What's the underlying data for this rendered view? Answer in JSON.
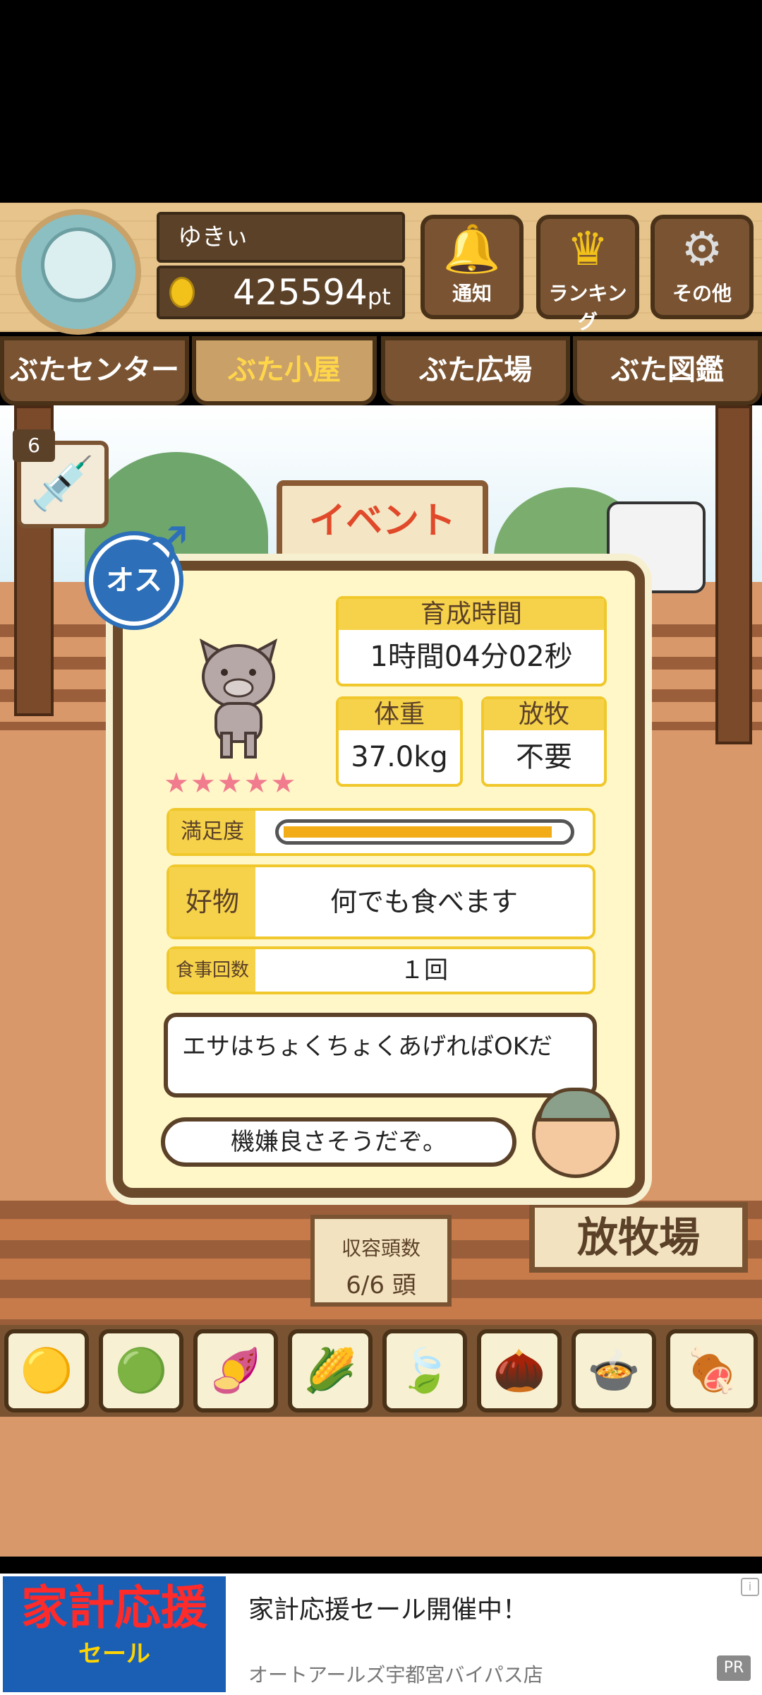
{
  "profile": {
    "name": "ゆきぃ",
    "points": "425594",
    "points_unit": "pt"
  },
  "top_buttons": [
    {
      "label": "通知",
      "icon": "bell-icon"
    },
    {
      "label": "ランキング",
      "icon": "crown-icon"
    },
    {
      "label": "その他",
      "icon": "gear-icon"
    }
  ],
  "tabs": [
    {
      "label": "ぶたセンター",
      "active": false
    },
    {
      "label": "ぶた小屋",
      "active": true
    },
    {
      "label": "ぶた広場",
      "active": false
    },
    {
      "label": "ぶた図鑑",
      "active": false
    }
  ],
  "scene": {
    "event_sign": "イベント",
    "item_count": "6"
  },
  "pig": {
    "gender_label": "オス",
    "stars": "★★★★★",
    "raising_time_label": "育成時間",
    "raising_time": "1時間04分02秒",
    "weight_label": "体重",
    "weight": "37.0kg",
    "pasture_label": "放牧",
    "pasture": "不要",
    "satisfaction_label": "満足度",
    "satisfaction_fraction": 0.95,
    "favorite_label": "好物",
    "favorite": "何でも食べます",
    "meals_label": "食事回数",
    "meals": "１回",
    "tip": "エサはちょくちょくあげればOKだ",
    "comment": "機嫌良さそうだぞ。"
  },
  "capacity": {
    "label": "収容頭数",
    "value": "6/6 頭"
  },
  "pasture_sign": "放牧場",
  "foods": [
    "feed-icon",
    "feed-icon",
    "sweet-potato-icon",
    "corn-icon",
    "leaf-icon",
    "acorn-icon",
    "feed-plate-icon",
    "meat-plate-icon"
  ],
  "ad": {
    "image_text": "家計応援",
    "image_sub": "セール",
    "title": "家計応援セール開催中！",
    "sponsor": "オートアールズ宇都宮バイパス店",
    "pr": "PR"
  },
  "colors": {
    "wood": "#7a5432",
    "accent_yellow": "#f6d24a",
    "male_blue": "#2d6fb8",
    "gauge": "#f2ac18"
  }
}
